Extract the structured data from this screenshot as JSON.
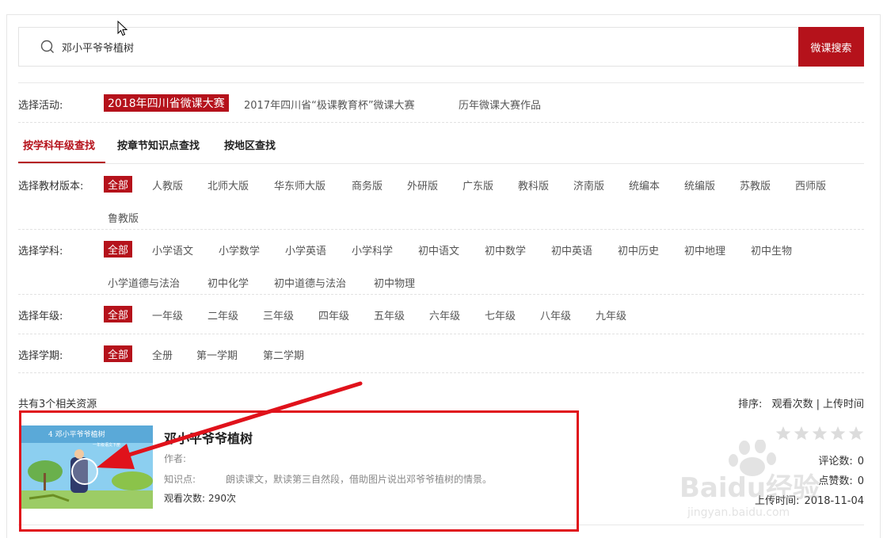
{
  "search": {
    "value": "邓小平爷爷植树",
    "button_label": "微课搜索"
  },
  "activity": {
    "label": "选择活动:",
    "items": [
      "2018年四川省微课大赛",
      "2017年四川省“极课教育杯”微课大赛",
      "历年微课大赛作品"
    ]
  },
  "tabs": [
    "按学科年级查找",
    "按章节知识点查找",
    "按地区查找"
  ],
  "edition": {
    "label": "选择教材版本:",
    "items": [
      "全部",
      "人教版",
      "北师大版",
      "华东师大版",
      "商务版",
      "外研版",
      "广东版",
      "教科版",
      "济南版",
      "统编本",
      "统编版",
      "苏教版",
      "西师版",
      "鲁教版"
    ]
  },
  "subject": {
    "label": "选择学科:",
    "items": [
      "全部",
      "小学语文",
      "小学数学",
      "小学英语",
      "小学科学",
      "初中语文",
      "初中数学",
      "初中英语",
      "初中历史",
      "初中地理",
      "初中生物",
      "小学道德与法治",
      "初中化学",
      "初中道德与法治",
      "初中物理"
    ]
  },
  "grade": {
    "label": "选择年级:",
    "items": [
      "全部",
      "一年级",
      "二年级",
      "三年级",
      "四年级",
      "五年级",
      "六年级",
      "七年级",
      "八年级",
      "九年级"
    ]
  },
  "term": {
    "label": "选择学期:",
    "items": [
      "全部",
      "全册",
      "第一学期",
      "第二学期"
    ]
  },
  "results": {
    "summary_prefix": "共有",
    "count": "3",
    "summary_suffix": "个相关资源",
    "sort_label": "排序:",
    "sort_views": "观看次数",
    "sort_sep": "|",
    "sort_time": "上传时间"
  },
  "result_item": {
    "title": "邓小平爷爷植树",
    "thumb_caption": "4 邓小平爷爷植树",
    "thumb_subcaption": "一年级语文下册",
    "author_label": "作者:",
    "kp_label": "知识点:",
    "kp_text": "朗读课文，默读第三自然段，借助图片说出邓爷爷植树的情景。",
    "views_label": "观看次数:",
    "views_value": "290次",
    "comments_label": "评论数:",
    "comments_value": "0",
    "likes_label": "点赞数:",
    "likes_value": "0",
    "upload_label": "上传时间:",
    "upload_value": "2018-11-04",
    "rating": 0
  },
  "watermark": {
    "text": "Baidu经验",
    "url_text": "jingyan.baidu.com"
  },
  "colors": {
    "accent": "#b5121b",
    "highlight": "#e0121b"
  }
}
